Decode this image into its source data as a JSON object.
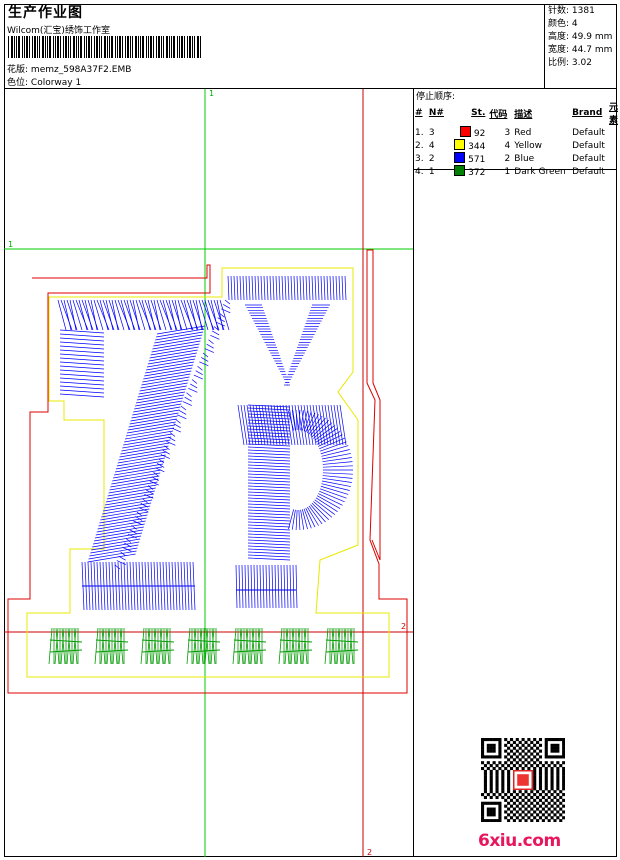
{
  "header": {
    "title": "生产作业图",
    "software": "Wilcom(汇宝)绣饰工作室",
    "design_file_label": "花版:",
    "design_file": "memz_598A37F2.EMB",
    "colorway_label": "色位:",
    "colorway": "Colorway 1"
  },
  "stats": [
    {
      "label": "针数:",
      "value": "1381"
    },
    {
      "label": "颜色:",
      "value": "4"
    },
    {
      "label": "高度:",
      "value": "49.9 mm"
    },
    {
      "label": "宽度:",
      "value": "44.7 mm"
    },
    {
      "label": "比例:",
      "value": "3.02"
    }
  ],
  "stop_sequence": {
    "title": "停止顺序:",
    "headers": [
      "#",
      "N#",
      "St.",
      "代码",
      "描述",
      "Brand",
      "元素"
    ],
    "rows": [
      {
        "idx": "1.",
        "n": "3",
        "color": "#ff0000",
        "st": "92",
        "code": "3",
        "desc": "Red",
        "brand": "Default"
      },
      {
        "idx": "2.",
        "n": "4",
        "color": "#ffff00",
        "st": "344",
        "code": "4",
        "desc": "Yellow",
        "brand": "Default"
      },
      {
        "idx": "3.",
        "n": "2",
        "color": "#0000ff",
        "st": "571",
        "code": "2",
        "desc": "Blue",
        "brand": "Default"
      },
      {
        "idx": "4.",
        "n": "1",
        "color": "#008000",
        "st": "372",
        "code": "1",
        "desc": "Dark Green",
        "brand": "Default"
      }
    ]
  },
  "axis_labels": {
    "top": "1",
    "left": "1",
    "right": "2",
    "bottom": "2"
  },
  "design": {
    "big_text": "7",
    "top_letter": "V",
    "mid_letter": "P",
    "bottom_text": "EASTERN"
  },
  "colors": {
    "red": "#ff0000",
    "yellow": "#ffff00",
    "blue": "#0000ff",
    "green": "#009900",
    "guide": "#00cc00"
  },
  "watermark": "6xiu.com"
}
